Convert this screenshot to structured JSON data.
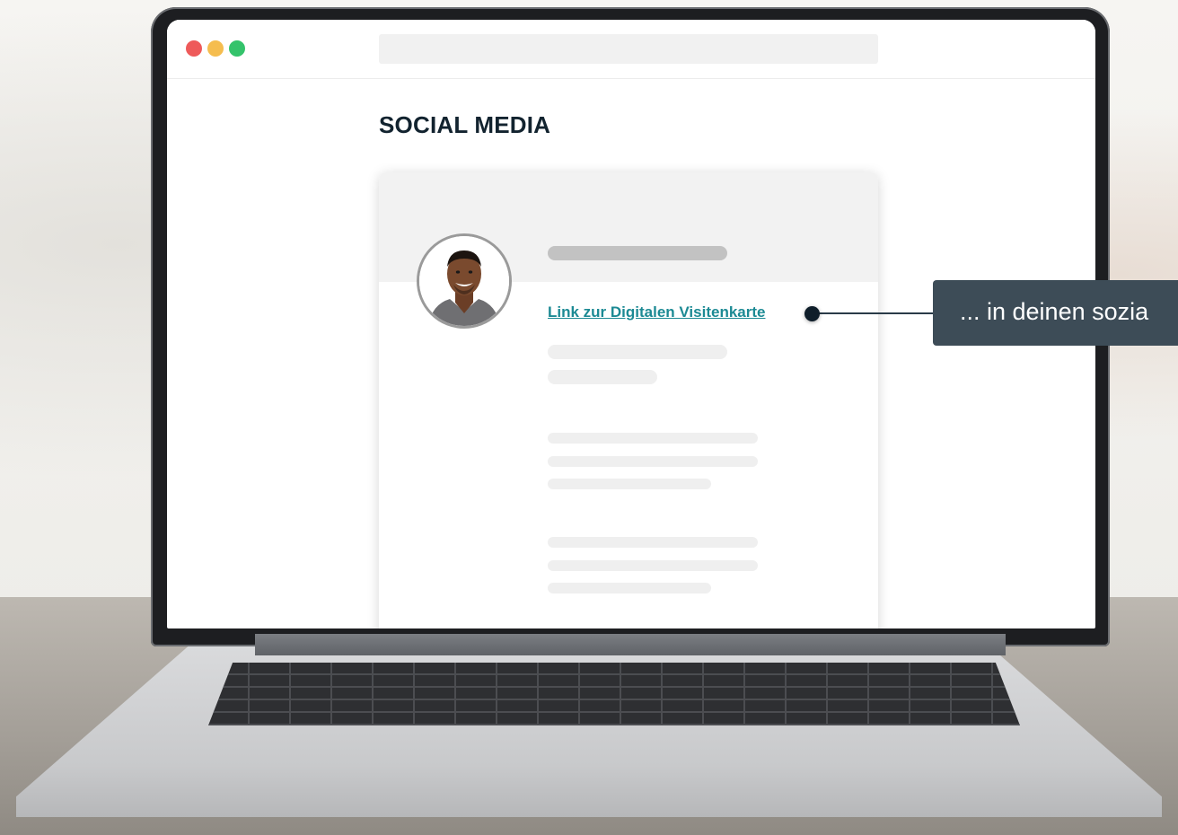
{
  "window": {
    "traffic_lights": {
      "close": "#ee5a5a",
      "minimize": "#f5bd4f",
      "zoom": "#34c36b"
    },
    "url": ""
  },
  "page": {
    "title": "SOCIAL MEDIA"
  },
  "profile_card": {
    "link_text": "Link zur Digitalen Visitenkarte",
    "link_color": "#1c8a94"
  },
  "callout": {
    "text": "... in deinen sozia"
  }
}
